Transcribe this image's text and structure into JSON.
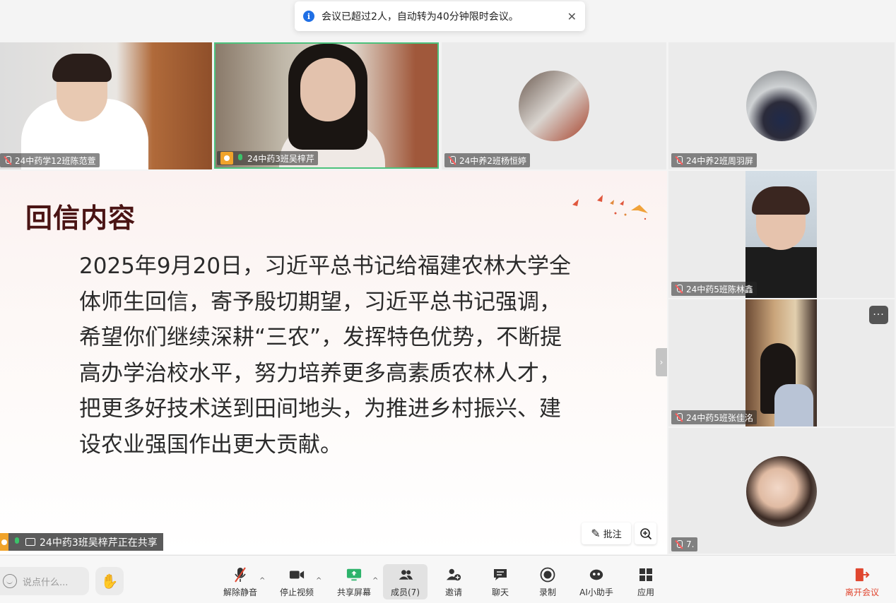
{
  "toast": {
    "message": "会议已超过2人，自动转为40分钟限时会议。",
    "close": "✕"
  },
  "participants": {
    "p1": "24中药学12班陈范萱",
    "p2": "24中药3班吴梓芹",
    "p3": "24中养2班杨恒婷",
    "p4": "24中养2班周羽屏",
    "p5": "24中药5班陈林鑫",
    "p6": "24中药5班张佳洺",
    "p7": "7."
  },
  "slide": {
    "title": "回信内容",
    "body": "2025年9月20日，习近平总书记给福建农林大学全体师生回信，寄予殷切期望，习近平总书记强调，希望你们继续深耕“三农”，发挥特色优势，不断提高办学治校水平，努力培养更多高素质农林人才，把更多好技术送到田间地头，为推进乡村振兴、建设农业强国作出更大贡献。"
  },
  "sharing": {
    "label": "24中药3班吴梓芹正在共享"
  },
  "slide_controls": {
    "annotate": "批注"
  },
  "chat": {
    "placeholder": "说点什么..."
  },
  "toolbar": {
    "unmute": "解除静音",
    "stop_video": "停止视频",
    "share_screen": "共享屏幕",
    "members": "成员(7)",
    "invite": "邀请",
    "chat": "聊天",
    "record": "录制",
    "ai_assistant": "AI小助手",
    "apps": "应用",
    "leave": "离开会议"
  },
  "colors": {
    "accent_green": "#3bc26a",
    "leave_red": "#e0462f",
    "info_blue": "#1f6fe5",
    "slide_title": "#4a1414"
  }
}
